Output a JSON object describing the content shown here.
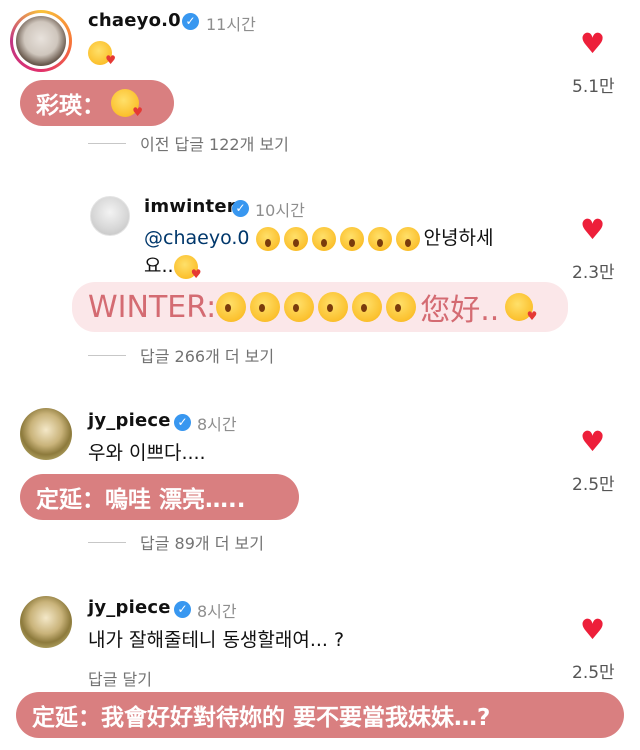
{
  "comments": [
    {
      "username": "chaeyo.0",
      "time": "11시간",
      "text": "",
      "likes": "5.1만",
      "replies": "이전 답글 122개 보기",
      "subtitle": "彩瑛："
    },
    {
      "username": "imwinter",
      "time": "10시간",
      "mention": "@chaeyo.0",
      "text_line1_suffix": "안녕하세",
      "text_line2": "요..",
      "likes": "2.3만",
      "replies": "답글 266개 더 보기",
      "subtitle_prefix": "WINTER:",
      "subtitle_suffix": "您好.."
    },
    {
      "username": "jy_piece",
      "time": "8시간",
      "text": "우와 이쁘다....",
      "likes": "2.5만",
      "replies": "답글 89개 더 보기",
      "subtitle": "定延：嗚哇 漂亮….."
    },
    {
      "username": "jy_piece",
      "time": "8시간",
      "text": "내가 잘해줄테니 동생할래여... ?",
      "likes": "2.5만",
      "reply_link": "답글 달기",
      "subtitle": "定延：我會好好對待妳的 要不要當我妹妹…?"
    }
  ],
  "icons": {
    "heart": "♥",
    "verified": "✓"
  },
  "colors": {
    "heart": "#ed1f3a",
    "verified": "#3897f0",
    "subtitle_red": "#d97f80",
    "subtitle_pink": "#fbe7e9"
  }
}
